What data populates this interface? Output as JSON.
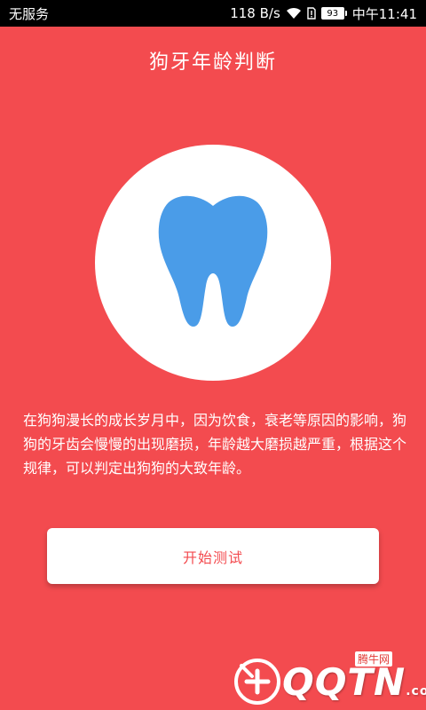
{
  "status_bar": {
    "carrier": "无服务",
    "net_speed": "118 B/s",
    "battery": "93",
    "time": "中午11:41"
  },
  "header": {
    "title": "狗牙年龄判断"
  },
  "hero": {
    "icon": "tooth-icon",
    "icon_color": "#4a9ce8"
  },
  "content": {
    "description": "在狗狗漫长的成长岁月中，因为饮食，衰老等原因的影响，狗狗的牙齿会慢慢的出现磨损，年龄越大磨损越严重，根据这个规律，可以判定出狗狗的大致年龄。"
  },
  "actions": {
    "start_label": "开始测试"
  },
  "watermark": {
    "brand": "QQTN",
    "suffix": ".com",
    "sub": "腾牛网"
  },
  "colors": {
    "background": "#f34b4f",
    "accent_text": "#f34b4f",
    "tooth": "#4a9ce8"
  }
}
